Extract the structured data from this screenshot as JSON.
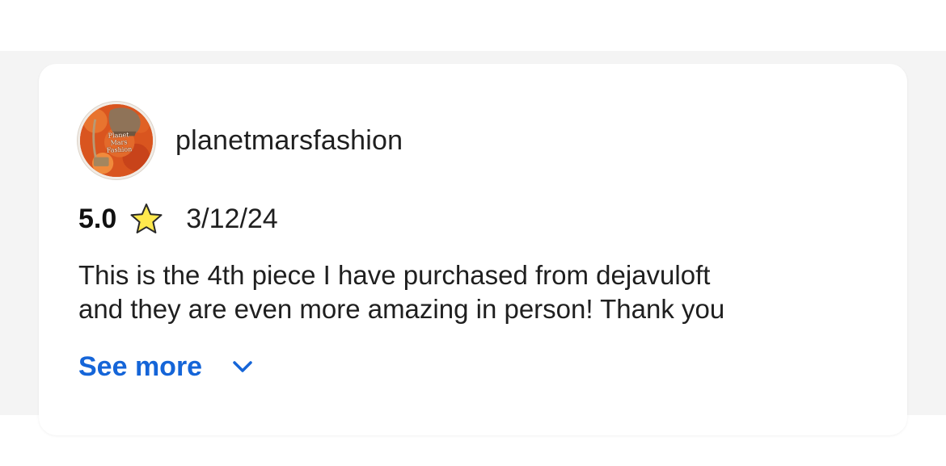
{
  "review": {
    "username": "planetmarsfashion",
    "avatar": {
      "icon": "shop-logo-avatar",
      "logo_text": "Planet Mars Fashion"
    },
    "rating": "5.0",
    "rating_icon": "star-icon",
    "date": "3/12/24",
    "text_lines": [
      "This is the 4th piece I have purchased from dejavuloft",
      "and they are even more amazing in person! Thank you"
    ],
    "see_more_label": "See more",
    "see_more_icon": "chevron-down-icon"
  },
  "colors": {
    "link": "#1565d8",
    "star_fill": "#ffe94d",
    "star_stroke": "#2a2a2a",
    "avatar_primary": "#d9551f",
    "card_background": "#ffffff",
    "page_background": "#f4f4f4"
  }
}
